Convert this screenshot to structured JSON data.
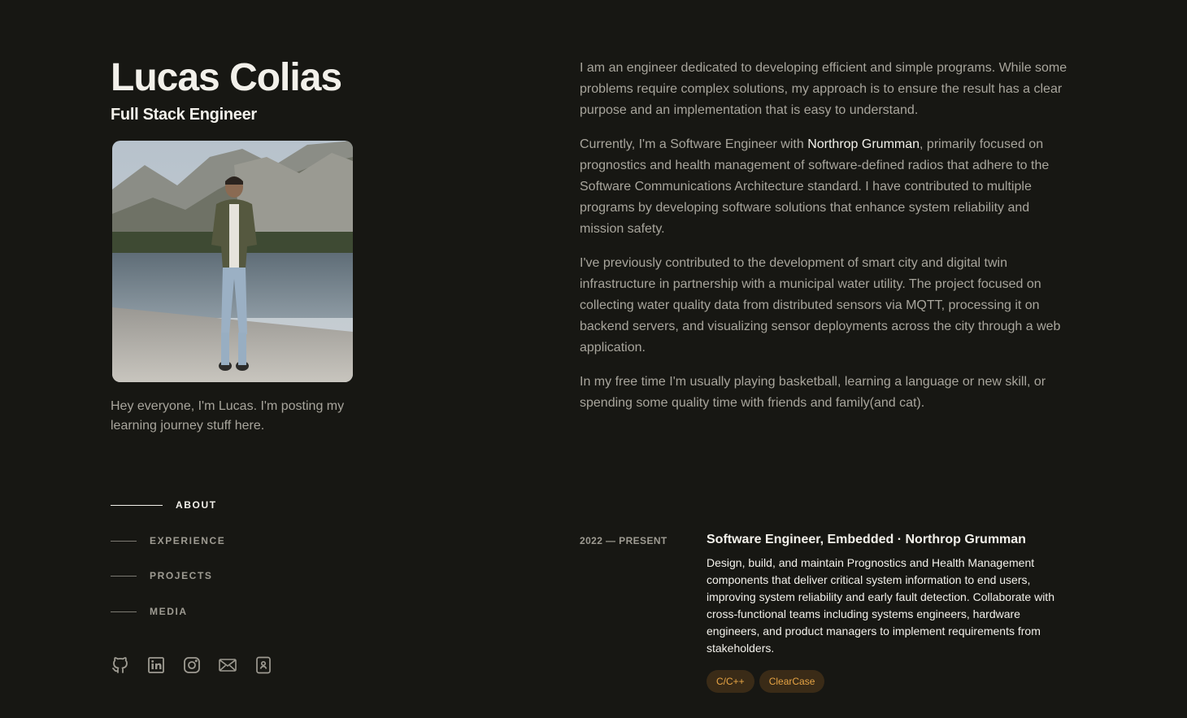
{
  "profile": {
    "name": "Lucas Colias",
    "role": "Full Stack Engineer",
    "tagline": "Hey everyone, I'm Lucas. I'm posting my learning journey stuff here."
  },
  "nav": {
    "items": [
      {
        "label": "ABOUT",
        "active": true
      },
      {
        "label": "EXPERIENCE",
        "active": false
      },
      {
        "label": "PROJECTS",
        "active": false
      },
      {
        "label": "MEDIA",
        "active": false
      }
    ]
  },
  "socials": [
    {
      "icon": "github-icon"
    },
    {
      "icon": "linkedin-icon"
    },
    {
      "icon": "instagram-icon"
    },
    {
      "icon": "mail-icon"
    },
    {
      "icon": "resume-icon"
    }
  ],
  "about": {
    "p1": "I am an engineer dedicated to developing efficient and simple programs. While some problems require complex solutions, my approach is to ensure the result has a clear purpose and an implementation that is easy to understand.",
    "p2_before": "Currently, I'm a Software Engineer with ",
    "p2_link": "Northrop Grumman",
    "p2_after": ", primarily focused on prognostics and health management of software-defined radios that adhere to the Software Communications Architecture standard. I have contributed to multiple programs by developing software solutions that enhance system reliability and mission safety.",
    "p3": "I've previously contributed to the development of smart city and digital twin infrastructure in partnership with a municipal water utility. The project focused on collecting water quality data from distributed sensors via MQTT, processing it on backend servers, and visualizing sensor deployments across the city through a web application.",
    "p4": "In my free time I'm usually playing basketball, learning a language or new skill, or spending some quality time with friends and family(and cat)."
  },
  "experience": [
    {
      "date": "2022 — PRESENT",
      "title": "Software Engineer, Embedded · Northrop Grumman",
      "description": "Design, build, and maintain Prognostics and Health Management components that deliver critical system information to end users, improving system reliability and early fault detection. Collaborate with cross-functional teams including systems engineers, hardware engineers, and product managers to implement requirements from stakeholders.",
      "tags": [
        "C/C++",
        "ClearCase"
      ]
    }
  ],
  "colors": {
    "background": "#171713",
    "text_primary": "#f2f0ea",
    "text_muted": "#a8a59c",
    "tag_bg": "#3a2b17",
    "tag_text": "#e7a444"
  }
}
